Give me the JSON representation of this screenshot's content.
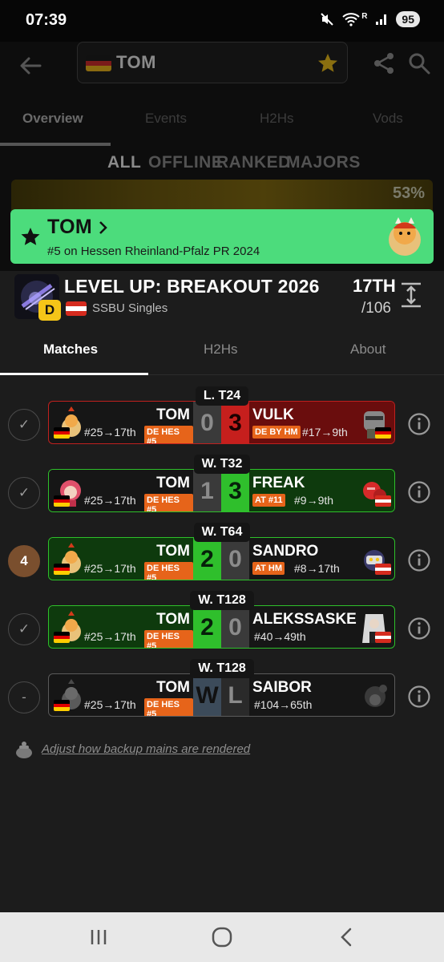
{
  "status_bar": {
    "time": "07:39",
    "signal_label": "R",
    "battery": "95"
  },
  "header": {
    "player_name": "TOM"
  },
  "bg_tabs": [
    "Overview",
    "Events",
    "H2Hs",
    "Vods"
  ],
  "filters": [
    "ALL",
    "OFFLINE",
    "RANKED",
    "MAJORS"
  ],
  "bg_card": {
    "percent": "53%"
  },
  "banner": {
    "name": "TOM",
    "subtitle": "#5 on Hessen Rheinland-Pfalz PR 2024"
  },
  "event": {
    "tier": "D",
    "title": "LEVEL UP: BREAKOUT 2026",
    "subtitle": "SSBU Singles",
    "placement": "17TH",
    "entrants": "/106"
  },
  "tabs": [
    "Matches",
    "H2Hs",
    "About"
  ],
  "matches": [
    {
      "round": "L. T24",
      "status": "✓",
      "player": "TOM",
      "player_seed": "#25→17th",
      "player_pr": "DE HES #5",
      "score1": "0",
      "score2": "3",
      "opponent": "VULK",
      "opponent_pr": "DE BY HM",
      "opponent_seed": "#17→9th"
    },
    {
      "round": "W. T32",
      "status": "✓",
      "player": "TOM",
      "player_seed": "#25→17th",
      "player_pr": "DE HES #5",
      "score1": "1",
      "score2": "3",
      "opponent": "FREAK",
      "opponent_pr": "AT #11",
      "opponent_seed": "#9→9th"
    },
    {
      "round": "W. T64",
      "status": "4",
      "player": "TOM",
      "player_seed": "#25→17th",
      "player_pr": "DE HES #5",
      "score1": "2",
      "score2": "0",
      "opponent": "SANDRO",
      "opponent_pr": "AT HM",
      "opponent_seed": "#8→17th"
    },
    {
      "round": "W. T128",
      "status": "✓",
      "player": "TOM",
      "player_seed": "#25→17th",
      "player_pr": "DE HES #5",
      "score1": "2",
      "score2": "0",
      "opponent": "ALEKSSASKE",
      "opponent_pr": "",
      "opponent_seed": "#40→49th"
    },
    {
      "round": "W. T128",
      "status": "-",
      "player": "TOM",
      "player_seed": "#25→17th",
      "player_pr": "DE HES #5",
      "score1": "W",
      "score2": "L",
      "opponent": "SAIBOR",
      "opponent_pr": "",
      "opponent_seed": "#104→65th"
    }
  ],
  "footer_link": "Adjust how backup mains are rendered",
  "colors": {
    "banner_green": "#4cdc7c",
    "win_green": "#2fbf2c",
    "loss_red": "#c61f1d",
    "pr_orange": "#e6641a",
    "tier_yellow": "#f5c518"
  },
  "icons": [
    "back-arrow-icon",
    "star-icon",
    "share-icon",
    "search-icon",
    "expand-icon",
    "info-icon",
    "check-icon",
    "pot-icon"
  ]
}
